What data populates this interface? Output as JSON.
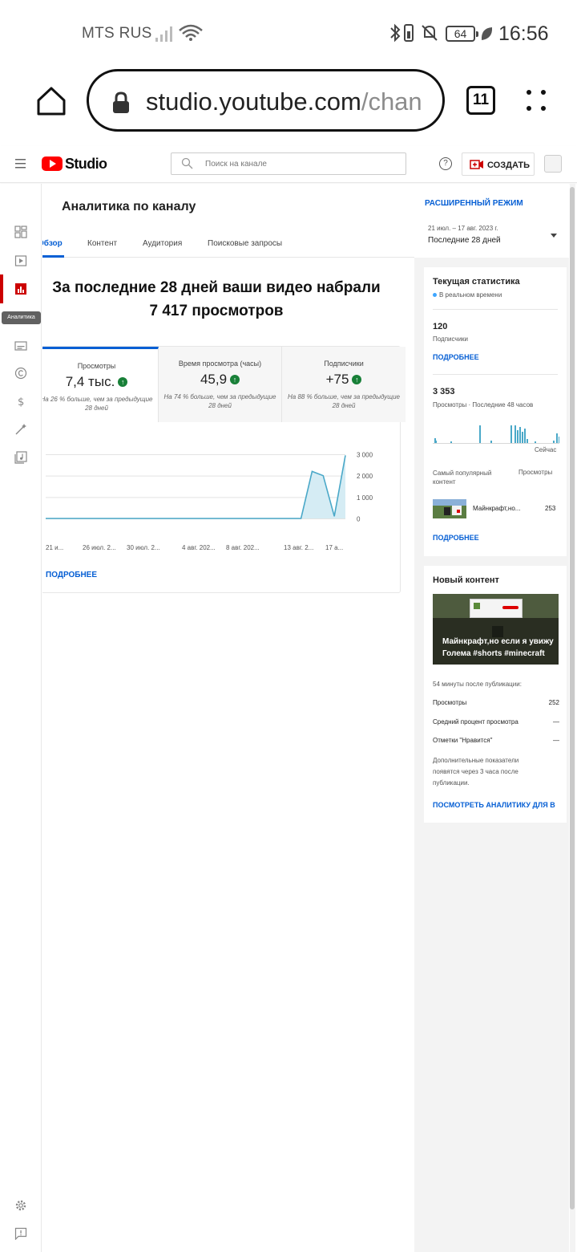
{
  "status_bar": {
    "carrier": "MTS RUS",
    "battery": "64",
    "time": "16:56",
    "icons": [
      "signal-icon",
      "wifi-icon",
      "bluetooth-icon",
      "vibrate-icon",
      "mute-icon",
      "battery-icon",
      "leaf-icon"
    ]
  },
  "browser": {
    "url_host": "studio.youtube.com",
    "url_path": "/chan",
    "tab_count": "11"
  },
  "header": {
    "brand": "Studio",
    "search_placeholder": "Поиск на канале",
    "help": "?",
    "create_label": "СОЗДАТЬ"
  },
  "rail": {
    "active_item": "analytics",
    "tooltip": "Аналитика"
  },
  "main": {
    "title": "Аналитика по каналу",
    "tabs": [
      {
        "label": "Обзор",
        "active": true
      },
      {
        "label": "Контент",
        "active": false
      },
      {
        "label": "Аудитория",
        "active": false
      },
      {
        "label": "Поисковые запросы",
        "active": false
      }
    ],
    "headline_line1": "За последние 28 дней ваши видео набрали",
    "headline_line2": "7 417 просмотров",
    "metrics": [
      {
        "label": "Просмотры",
        "value": "7,4 тыс.",
        "note1": "На 26 % больше, чем за предыдущие",
        "note2": "28 дней"
      },
      {
        "label": "Время просмотра (часы)",
        "value": "45,9",
        "note1": "На 74 % больше, чем за предыдущие",
        "note2": "28 дней"
      },
      {
        "label": "Подписчики",
        "value": "+75",
        "note1": "На 88 % больше, чем за предыдущие",
        "note2": "28 дней"
      }
    ],
    "more_link": "ПОДРОБНЕЕ"
  },
  "chart_data": {
    "type": "area",
    "series": [
      {
        "values": [
          0,
          0,
          0,
          0,
          0,
          0,
          0,
          0,
          0,
          0,
          0,
          0,
          0,
          0,
          0,
          0,
          0,
          0,
          0,
          0,
          0,
          0,
          0,
          0,
          2200,
          2000,
          100,
          2950
        ]
      }
    ],
    "x_tick_labels": [
      "21 и...",
      "26 июл. 2...",
      "30 июл. 2...",
      "4 авг. 202...",
      "8 авг. 202...",
      "13 авг. 2...",
      "17 а..."
    ],
    "y_tick_labels": [
      "3 000",
      "2 000",
      "1 000",
      "0"
    ],
    "ylim": [
      0,
      3000
    ],
    "grid": true,
    "color": "#4aa8c8"
  },
  "right": {
    "advanced_mode": "РАСШИРЕННЫЙ РЕЖИМ",
    "date_range_small": "21 июл. – 17 авг. 2023 г.",
    "date_range_main": "Последние 28 дней",
    "realtime": {
      "title": "Текущая статистика",
      "live_label": "В реальном времени",
      "subs_value": "120",
      "subs_label": "Подписчики",
      "more1": "ПОДРОБНЕЕ",
      "views_value": "3 353",
      "views_label": "Просмотры · Последние 48 часов",
      "now_label": "Сейчас",
      "top_content_label": "Самый популярный контент",
      "views_col_label": "Просмотры",
      "top_title": "Майнкрафт,но...",
      "top_views": "253",
      "more2": "ПОДРОБНЕЕ"
    },
    "new_content": {
      "title": "Новый контент",
      "thumb_title": "Майнкрафт,но если я увижу Голема #shorts #minecraft",
      "since": "54 минуты после публикации:",
      "rows": [
        {
          "label": "Просмотры",
          "value": "252"
        },
        {
          "label": "Средний процент просмотра",
          "value": "—"
        },
        {
          "label": "Отметки \"Нравится\"",
          "value": "—"
        }
      ],
      "note": "Дополнительные показатели появятся через 3 часа после публикации.",
      "link": "ПОСМОТРЕТЬ АНАЛИТИКУ ДЛЯ В"
    }
  }
}
